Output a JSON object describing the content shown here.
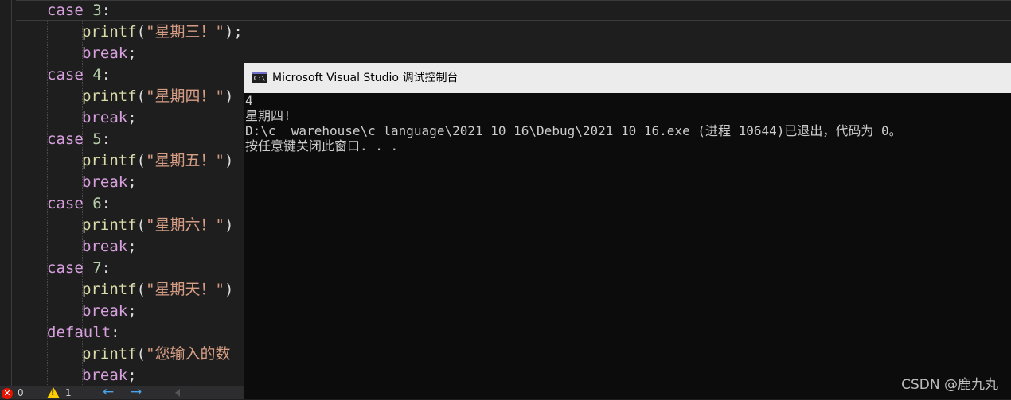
{
  "editor": {
    "lines": [
      {
        "indent": 1,
        "tokens": [
          {
            "c": "kw",
            "t": "case"
          },
          {
            "c": "pun",
            "t": " "
          },
          {
            "c": "num",
            "t": "3"
          },
          {
            "c": "pun",
            "t": ":"
          }
        ]
      },
      {
        "indent": 2,
        "tokens": [
          {
            "c": "fn",
            "t": "printf"
          },
          {
            "c": "pun",
            "t": "("
          },
          {
            "c": "str",
            "t": "\"星期三！\""
          },
          {
            "c": "pun",
            "t": ");"
          }
        ]
      },
      {
        "indent": 2,
        "tokens": [
          {
            "c": "kw",
            "t": "break"
          },
          {
            "c": "pun",
            "t": ";"
          }
        ]
      },
      {
        "indent": 1,
        "tokens": [
          {
            "c": "kw",
            "t": "case"
          },
          {
            "c": "pun",
            "t": " "
          },
          {
            "c": "num",
            "t": "4"
          },
          {
            "c": "pun",
            "t": ":"
          }
        ]
      },
      {
        "indent": 2,
        "tokens": [
          {
            "c": "fn",
            "t": "printf"
          },
          {
            "c": "pun",
            "t": "("
          },
          {
            "c": "str",
            "t": "\"星期四！\""
          },
          {
            "c": "pun",
            "t": ")"
          }
        ]
      },
      {
        "indent": 2,
        "tokens": [
          {
            "c": "kw",
            "t": "break"
          },
          {
            "c": "pun",
            "t": ";"
          }
        ]
      },
      {
        "indent": 1,
        "tokens": [
          {
            "c": "kw",
            "t": "case"
          },
          {
            "c": "pun",
            "t": " "
          },
          {
            "c": "num",
            "t": "5"
          },
          {
            "c": "pun",
            "t": ":"
          }
        ]
      },
      {
        "indent": 2,
        "tokens": [
          {
            "c": "fn",
            "t": "printf"
          },
          {
            "c": "pun",
            "t": "("
          },
          {
            "c": "str",
            "t": "\"星期五！\""
          },
          {
            "c": "pun",
            "t": ")"
          }
        ]
      },
      {
        "indent": 2,
        "tokens": [
          {
            "c": "kw",
            "t": "break"
          },
          {
            "c": "pun",
            "t": ";"
          }
        ]
      },
      {
        "indent": 1,
        "tokens": [
          {
            "c": "kw",
            "t": "case"
          },
          {
            "c": "pun",
            "t": " "
          },
          {
            "c": "num",
            "t": "6"
          },
          {
            "c": "pun",
            "t": ":"
          }
        ]
      },
      {
        "indent": 2,
        "tokens": [
          {
            "c": "fn",
            "t": "printf"
          },
          {
            "c": "pun",
            "t": "("
          },
          {
            "c": "str",
            "t": "\"星期六！\""
          },
          {
            "c": "pun",
            "t": ")"
          }
        ]
      },
      {
        "indent": 2,
        "tokens": [
          {
            "c": "kw",
            "t": "break"
          },
          {
            "c": "pun",
            "t": ";"
          }
        ]
      },
      {
        "indent": 1,
        "tokens": [
          {
            "c": "kw",
            "t": "case"
          },
          {
            "c": "pun",
            "t": " "
          },
          {
            "c": "num",
            "t": "7"
          },
          {
            "c": "pun",
            "t": ":"
          }
        ]
      },
      {
        "indent": 2,
        "tokens": [
          {
            "c": "fn",
            "t": "printf"
          },
          {
            "c": "pun",
            "t": "("
          },
          {
            "c": "str",
            "t": "\"星期天！\""
          },
          {
            "c": "pun",
            "t": ")"
          }
        ]
      },
      {
        "indent": 2,
        "tokens": [
          {
            "c": "kw",
            "t": "break"
          },
          {
            "c": "pun",
            "t": ";"
          }
        ]
      },
      {
        "indent": 1,
        "tokens": [
          {
            "c": "kw",
            "t": "default"
          },
          {
            "c": "pun",
            "t": ":"
          }
        ]
      },
      {
        "indent": 2,
        "tokens": [
          {
            "c": "fn",
            "t": "printf"
          },
          {
            "c": "pun",
            "t": "("
          },
          {
            "c": "str",
            "t": "\"您输入的数"
          }
        ]
      },
      {
        "indent": 2,
        "tokens": [
          {
            "c": "kw",
            "t": "break"
          },
          {
            "c": "pun",
            "t": ";"
          }
        ]
      }
    ]
  },
  "statusbar": {
    "errors": "0",
    "warnings": "1",
    "nav_back": "←",
    "nav_forward": "→"
  },
  "console": {
    "title": "Microsoft Visual Studio 调试控制台",
    "icon_label": "C:\\",
    "lines": [
      "4",
      "星期四!",
      "D:\\c _warehouse\\c_language\\2021_10_16\\Debug\\2021_10_16.exe (进程 10644)已退出，代码为 0。",
      "按任意键关闭此窗口. . ."
    ]
  },
  "watermark": "CSDN @鹿九丸",
  "colors": {
    "editor_bg": "#1e1e1e",
    "keyword": "#d8a0df",
    "function": "#dcdcaa",
    "string": "#d69d85",
    "number": "#b5cea8",
    "console_bg": "#0c0c0c",
    "titlebar_bg": "#ececec"
  }
}
